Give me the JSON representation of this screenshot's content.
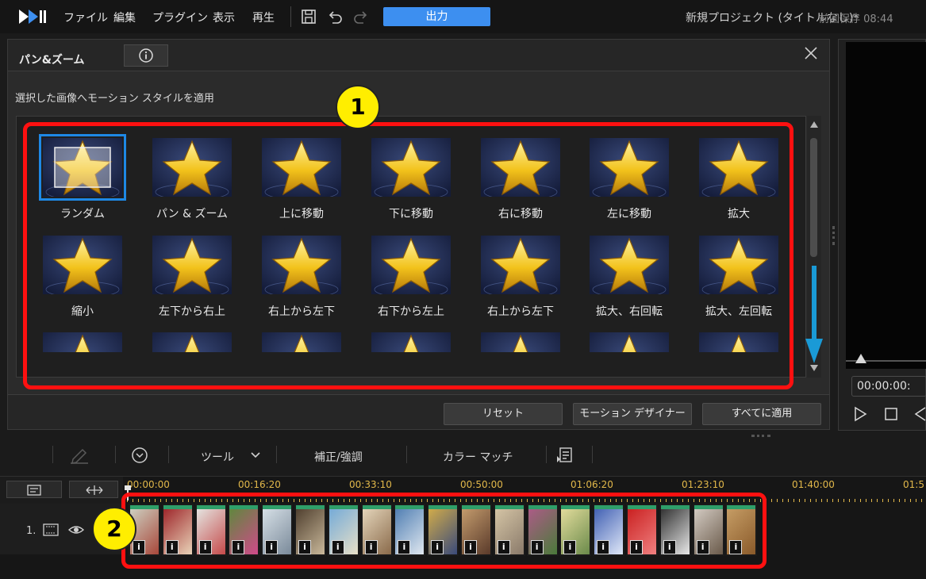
{
  "menu": {
    "items": [
      "ファイル",
      "編集",
      "プラグイン",
      "表示",
      "再生"
    ],
    "output_label": "出力",
    "project_title": "新規プロジェクト (タイトルなし)*",
    "save_status": "前回保存 08:44"
  },
  "dialog": {
    "title": "パン&ズーム",
    "instruction": "選択した画像へモーション スタイルを適用",
    "styles": [
      {
        "label": "ランダム"
      },
      {
        "label": "パン & ズーム"
      },
      {
        "label": "上に移動"
      },
      {
        "label": "下に移動"
      },
      {
        "label": "右に移動"
      },
      {
        "label": "左に移動"
      },
      {
        "label": "拡大"
      },
      {
        "label": "縮小"
      },
      {
        "label": "左下から右上"
      },
      {
        "label": "右上から左下"
      },
      {
        "label": "右下から左上"
      },
      {
        "label": "右上から左下"
      },
      {
        "label": "拡大、右回転"
      },
      {
        "label": "拡大、左回転"
      }
    ],
    "reset_label": "リセット",
    "motion_designer_label": "モーション デザイナー",
    "apply_all_label": "すべてに適用"
  },
  "callouts": {
    "one": "1",
    "two": "2"
  },
  "preview": {
    "timecode": "00:00:00:"
  },
  "timeline_toolbar": {
    "tools_label": "ツール",
    "correction_label": "補正/強調",
    "color_match_label": "カラー マッチ"
  },
  "timeline": {
    "ruler": [
      "00:00:00",
      "00:16:20",
      "00:33:10",
      "00:50:00",
      "01:06:20",
      "01:23:10",
      "01:40:00",
      "01:5"
    ],
    "track_number": "1.",
    "clip_info": "i",
    "clip_count": 19
  },
  "colors": {
    "accent": "#3d8ff0",
    "selection": "#1e88e5",
    "annotation_red": "#ff1010",
    "annotation_yellow": "#ffee00",
    "ruler_text": "#e2b84a"
  }
}
